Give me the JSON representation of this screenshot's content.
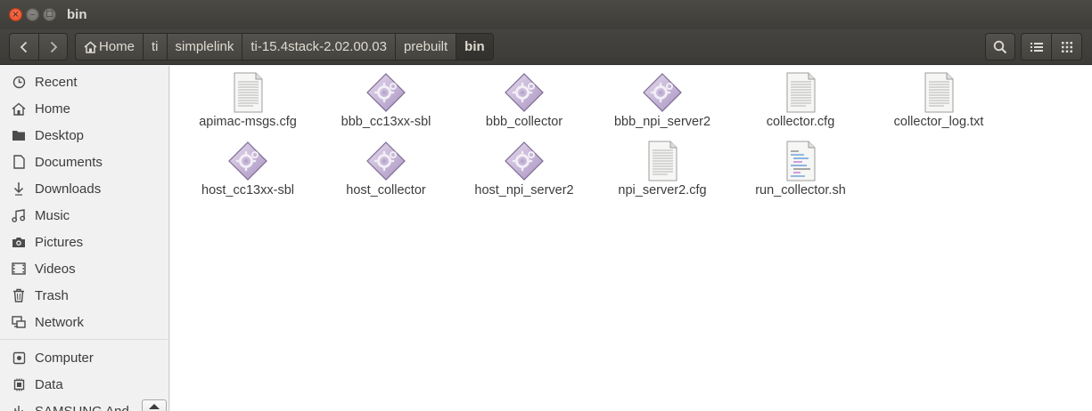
{
  "window": {
    "title": "bin"
  },
  "titlebar_buttons": {
    "close": "×",
    "minimize": "–",
    "maximize": "□"
  },
  "nav": {
    "back_glyph": "‹",
    "forward_glyph": "›"
  },
  "breadcrumb": [
    {
      "label": "Home",
      "icon": "home-icon"
    },
    {
      "label": "ti"
    },
    {
      "label": "simplelink"
    },
    {
      "label": "ti-15.4stack-2.02.00.03"
    },
    {
      "label": "prebuilt"
    },
    {
      "label": "bin",
      "active": true
    }
  ],
  "toolbar": {
    "search_icon": "search-icon",
    "list_view_icon": "list-view-icon",
    "grid_view_icon": "grid-view-icon"
  },
  "sidebar": {
    "items": [
      {
        "label": "Recent",
        "icon": "clock-icon"
      },
      {
        "label": "Home",
        "icon": "home-icon"
      },
      {
        "label": "Desktop",
        "icon": "folder-icon"
      },
      {
        "label": "Documents",
        "icon": "document-icon"
      },
      {
        "label": "Downloads",
        "icon": "download-icon"
      },
      {
        "label": "Music",
        "icon": "music-icon"
      },
      {
        "label": "Pictures",
        "icon": "camera-icon"
      },
      {
        "label": "Videos",
        "icon": "video-icon"
      },
      {
        "label": "Trash",
        "icon": "trash-icon"
      },
      {
        "label": "Network",
        "icon": "network-icon"
      }
    ],
    "devices": [
      {
        "label": "Computer",
        "icon": "drive-icon"
      },
      {
        "label": "Data",
        "icon": "chip-icon"
      },
      {
        "label": "SAMSUNG And",
        "icon": "usb-icon"
      }
    ]
  },
  "files": [
    {
      "name": "apimac-msgs.cfg",
      "type": "text"
    },
    {
      "name": "bbb_cc13xx-sbl",
      "type": "executable"
    },
    {
      "name": "bbb_collector",
      "type": "executable"
    },
    {
      "name": "bbb_npi_server2",
      "type": "executable"
    },
    {
      "name": "collector.cfg",
      "type": "text"
    },
    {
      "name": "collector_log.txt",
      "type": "text"
    },
    {
      "name": "host_cc13xx-sbl",
      "type": "executable"
    },
    {
      "name": "host_collector",
      "type": "executable"
    },
    {
      "name": "host_npi_server2",
      "type": "executable"
    },
    {
      "name": "npi_server2.cfg",
      "type": "text"
    },
    {
      "name": "run_collector.sh",
      "type": "script"
    }
  ]
}
